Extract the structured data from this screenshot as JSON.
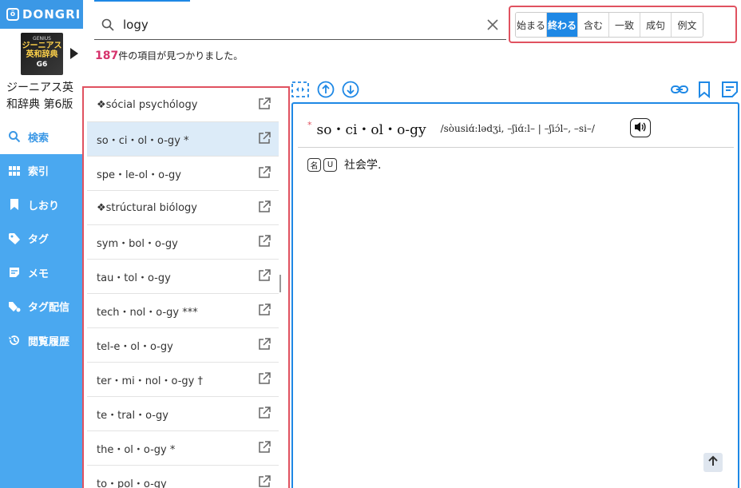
{
  "app": {
    "logo_text": "DONGRI",
    "logo_mark": "ö"
  },
  "dictionary": {
    "cover_line1": "GENIUS",
    "cover_line2": "ジーニアス",
    "cover_line3": "英和辞典",
    "cover_line4": "G6",
    "name": "ジーニアス英和辞典 第6版"
  },
  "nav": {
    "items": [
      {
        "label": "検索",
        "icon": "search-icon"
      },
      {
        "label": "索引",
        "icon": "grid-icon"
      },
      {
        "label": "しおり",
        "icon": "bookmark-icon"
      },
      {
        "label": "タグ",
        "icon": "tag-icon"
      },
      {
        "label": "メモ",
        "icon": "memo-icon"
      },
      {
        "label": "タグ配信",
        "icon": "tag-share-icon"
      },
      {
        "label": "閲覧履歴",
        "icon": "history-icon"
      }
    ]
  },
  "search": {
    "query": "logy",
    "placeholder": ""
  },
  "results": {
    "count": "187",
    "suffix": "件の項目が見つかりました。"
  },
  "modes": {
    "buttons": [
      "始まる",
      "終わる",
      "含む",
      "一致",
      "成句",
      "例文"
    ],
    "active": "終わる"
  },
  "list": {
    "items": [
      "❖sócial psychólogy",
      "so・ci・ol・o-gy *",
      "spe・le-ol・o-gy",
      "❖strúctural biólogy",
      "sym・bol・o-gy",
      "tau・tol・o-gy",
      "tech・nol・o-gy ***",
      "tel-e・ol・o-gy",
      "ter・mi・nol・o-gy †",
      "te・tral・o-gy",
      "the・ol・o-gy *",
      "to・pol・o-gy"
    ],
    "selected_index": 1
  },
  "entry": {
    "star": "*",
    "word": "so・ci・ol・o-gy",
    "pronunciation": "/sòusiɑ́:lədʒi, –ʃiɑ́:l– | –ʃiɔ́l–, –si–/",
    "tags": [
      "名",
      "U"
    ],
    "definition": "社会学."
  },
  "colors": {
    "accent": "#1e88e5",
    "sidebar": "#4aa8f0",
    "highlight": "#e05260"
  }
}
